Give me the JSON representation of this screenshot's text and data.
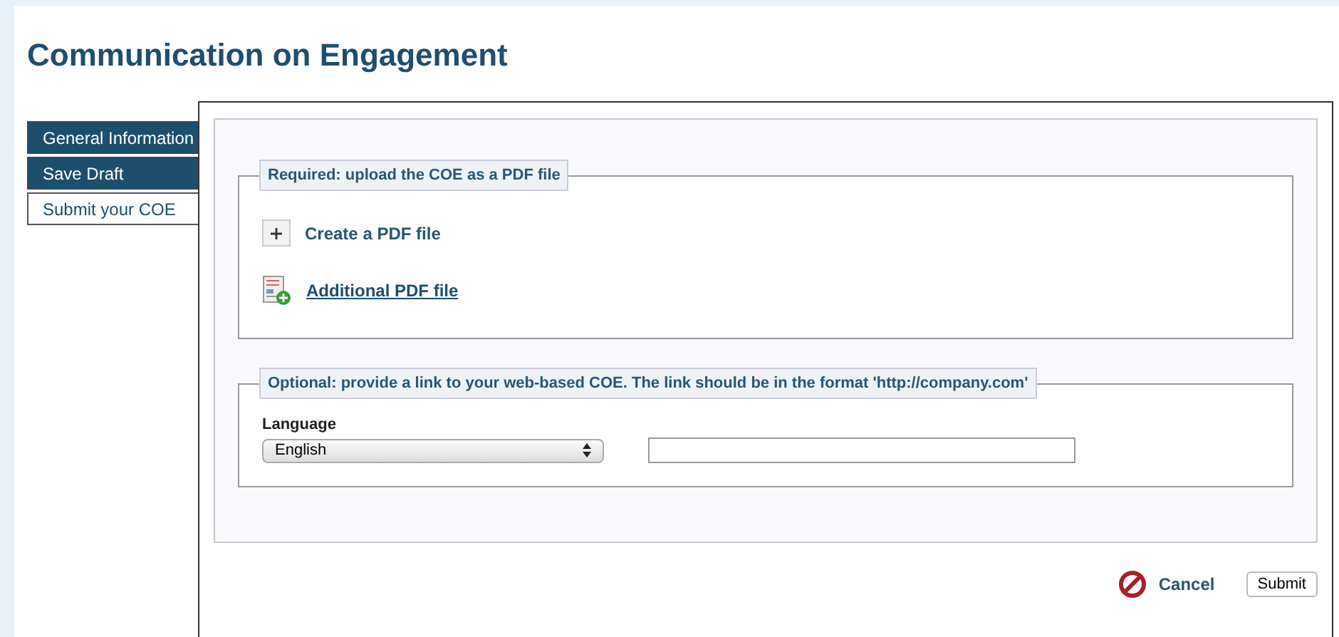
{
  "title": "Communication on Engagement",
  "tabs": [
    {
      "label": "General Information",
      "selected": false
    },
    {
      "label": "Save Draft",
      "selected": false
    },
    {
      "label": "Submit your COE",
      "selected": true
    }
  ],
  "required_section": {
    "legend": "Required: upload the COE as a PDF file",
    "create_label": "Create a PDF file",
    "additional_link": "Additional PDF file"
  },
  "optional_section": {
    "legend": "Optional: provide a link to your web-based COE. The link should be in the format 'http://company.com'",
    "language_label": "Language",
    "language_value": "English"
  },
  "actions": {
    "cancel": "Cancel",
    "submit": "Submit"
  }
}
